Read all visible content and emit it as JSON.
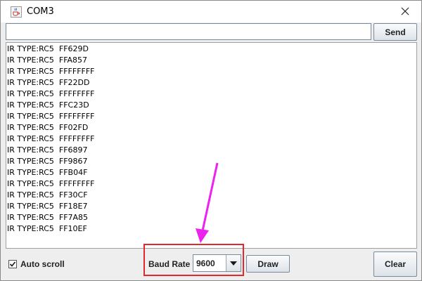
{
  "window": {
    "title": "COM3",
    "icons": {
      "app": "java-cup-icon",
      "close": "close-icon"
    }
  },
  "toolbar": {
    "input_value": "",
    "send_label": "Send"
  },
  "output": {
    "lines": [
      "IR TYPE:RC5  FF629D",
      "IR TYPE:RC5  FFA857",
      "IR TYPE:RC5  FFFFFFFF",
      "IR TYPE:RC5  FF22DD",
      "IR TYPE:RC5  FFFFFFFF",
      "IR TYPE:RC5  FFC23D",
      "IR TYPE:RC5  FFFFFFFF",
      "IR TYPE:RC5  FF02FD",
      "IR TYPE:RC5  FFFFFFFF",
      "IR TYPE:RC5  FF6897",
      "IR TYPE:RC5  FF9867",
      "IR TYPE:RC5  FFB04F",
      "IR TYPE:RC5  FFFFFFFF",
      "IR TYPE:RC5  FF30CF",
      "IR TYPE:RC5  FF18E7",
      "IR TYPE:RC5  FF7A85",
      "IR TYPE:RC5  FF10EF"
    ]
  },
  "footer": {
    "autoscroll_label": "Auto scroll",
    "autoscroll_checked": true,
    "baud_label": "Baud Rate",
    "baud_value": "9600",
    "draw_label": "Draw",
    "clear_label": "Clear"
  },
  "colors": {
    "annotation_box": "#e2282e",
    "annotation_arrow": "#ee22ee"
  }
}
